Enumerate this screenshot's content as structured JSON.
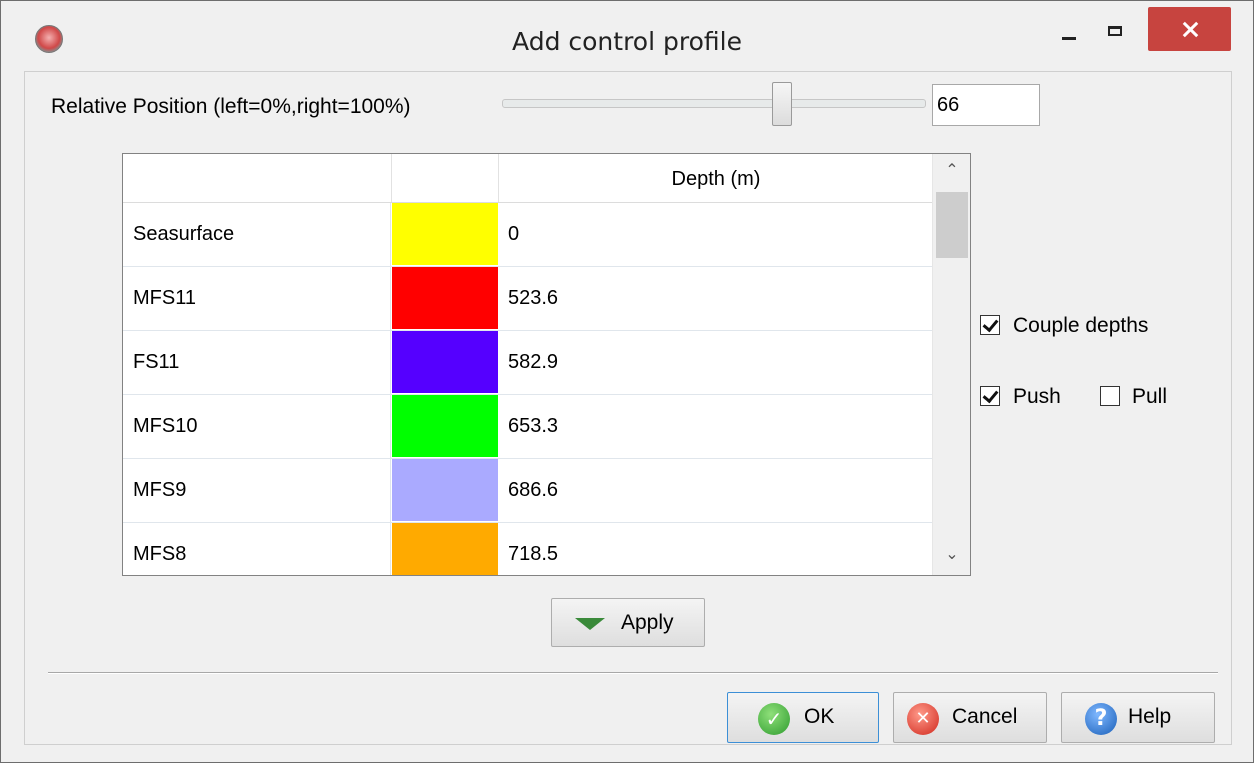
{
  "window": {
    "title": "Add control profile"
  },
  "position": {
    "label": "Relative Position (left=0%,right=100%)",
    "value": "66",
    "slider_fraction": 0.66
  },
  "table": {
    "columns": [
      "",
      "",
      "Depth (m)"
    ],
    "rows": [
      {
        "name": "Seasurface",
        "color": "#ffff00",
        "depth": "0"
      },
      {
        "name": "MFS11",
        "color": "#ff0000",
        "depth": "523.6"
      },
      {
        "name": "FS11",
        "color": "#5500ff",
        "depth": "582.9"
      },
      {
        "name": "MFS10",
        "color": "#00ff00",
        "depth": "653.3"
      },
      {
        "name": "MFS9",
        "color": "#aaaaff",
        "depth": "686.6"
      },
      {
        "name": "MFS8",
        "color": "#ffaa00",
        "depth": "718.5"
      }
    ]
  },
  "options": {
    "couple_depths": {
      "label": "Couple depths",
      "checked": true
    },
    "push": {
      "label": "Push",
      "checked": true
    },
    "pull": {
      "label": "Pull",
      "checked": false
    }
  },
  "buttons": {
    "apply": "Apply",
    "ok": "OK",
    "cancel": "Cancel",
    "help": "Help"
  },
  "icons": {
    "app": "app-logo-icon",
    "apply": "triangle-down-icon",
    "ok": "checkmark-circle-icon",
    "cancel": "x-circle-icon",
    "help": "question-circle-icon"
  }
}
